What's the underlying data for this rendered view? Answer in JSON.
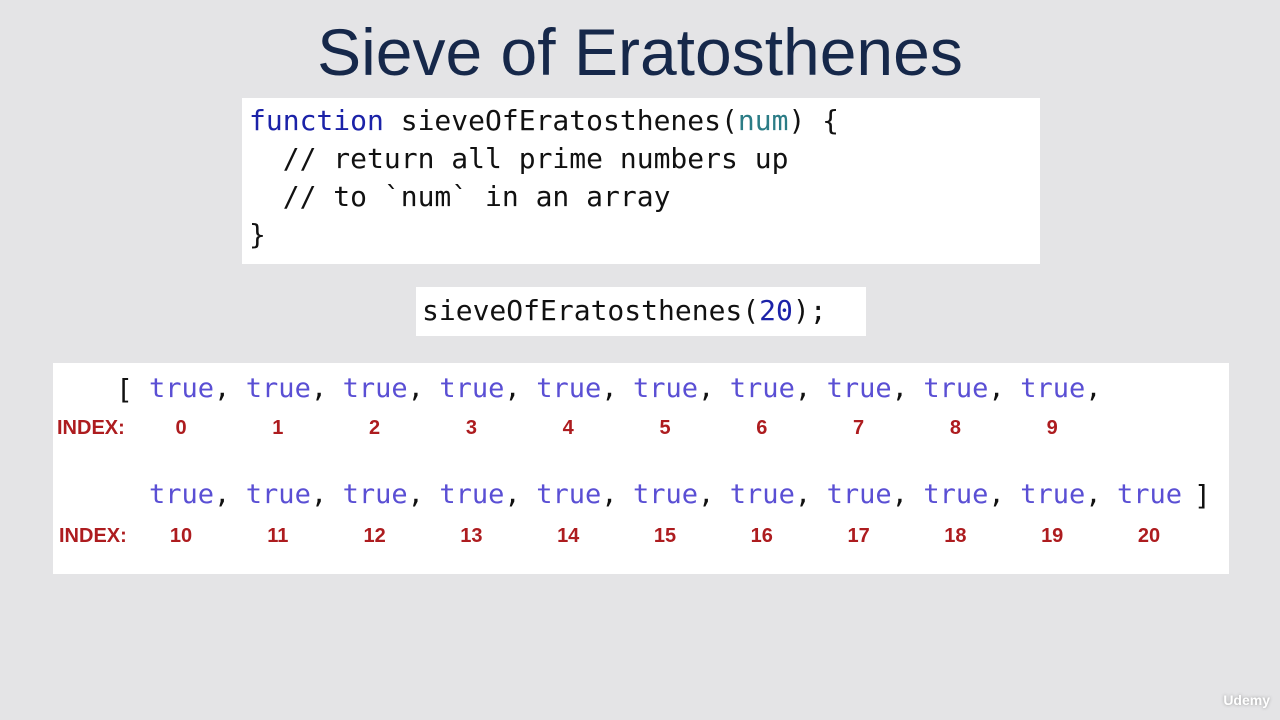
{
  "slide": {
    "title": "Sieve of Eratosthenes",
    "code": {
      "keyword": "function",
      "fn_name": " sieveOfEratosthenes(",
      "param": "num",
      "open": ") {",
      "comment1": "  // return all prime numbers up",
      "comment2": "  // to `num` in an array",
      "close": "}"
    },
    "call": {
      "prefix": "sieveOfEratosthenes(",
      "arg": "20",
      "suffix": ");"
    },
    "array": {
      "open_bracket": "[",
      "close_bracket": "]",
      "index_label": "INDEX:",
      "row1": {
        "values": [
          "true",
          "true",
          "true",
          "true",
          "true",
          "true",
          "true",
          "true",
          "true",
          "true"
        ],
        "indices": [
          "0",
          "1",
          "2",
          "3",
          "4",
          "5",
          "6",
          "7",
          "8",
          "9"
        ]
      },
      "row2": {
        "values": [
          "true",
          "true",
          "true",
          "true",
          "true",
          "true",
          "true",
          "true",
          "true",
          "true",
          "true"
        ],
        "indices": [
          "10",
          "11",
          "12",
          "13",
          "14",
          "15",
          "16",
          "17",
          "18",
          "19",
          "20"
        ]
      }
    },
    "watermark": "Udemy"
  }
}
